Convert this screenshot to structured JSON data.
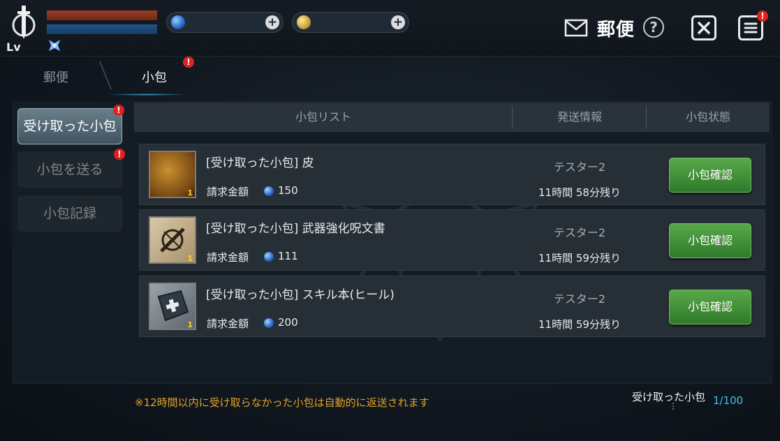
{
  "header": {
    "level_label": "Lv",
    "mail_title": "郵便",
    "help_symbol": "?",
    "close_symbol": "✕",
    "menu_badge": "!"
  },
  "currency": {
    "gem_plus": "+",
    "gold_plus": "+"
  },
  "tabs": [
    {
      "label": "郵便",
      "active": false
    },
    {
      "label": "小包",
      "active": true,
      "badge": "!"
    }
  ],
  "sidebar": {
    "items": [
      {
        "label": "受け取った小包",
        "active": true,
        "badge": "!"
      },
      {
        "label": "小包を送る",
        "active": false,
        "badge": "!"
      },
      {
        "label": "小包記録",
        "active": false
      }
    ]
  },
  "list": {
    "headers": [
      "小包リスト",
      "発送情報",
      "小包状態"
    ],
    "price_label": "請求金額",
    "rows": [
      {
        "icon": "leather-icon",
        "name": "[受け取った小包] 皮",
        "qty": "1",
        "price": "150",
        "sender": "テスター2",
        "time_left": "11時間 58分残り",
        "action": "小包確認"
      },
      {
        "icon": "scroll-icon",
        "name": "[受け取った小包] 武器強化呪文書",
        "qty": "1",
        "price": "111",
        "sender": "テスター2",
        "time_left": "11時間 59分残り",
        "action": "小包確認"
      },
      {
        "icon": "skill-book-icon",
        "name": "[受け取った小包] スキル本(ヒール)",
        "qty": "1",
        "price": "200",
        "sender": "テスター2",
        "time_left": "11時間 59分残り",
        "action": "小包確認"
      }
    ]
  },
  "footer": {
    "notice": "※12時間以内に受け取らなかった小包は自動的に返送されます",
    "counter_label": "受け取った小包",
    "counter_value": "1/100",
    "counter_dots": "⋮"
  },
  "colors": {
    "accent": "#3cc8e6",
    "notice": "#e0a22a",
    "confirm_button": "#4a9a3e",
    "alert_badge": "#e32020"
  }
}
